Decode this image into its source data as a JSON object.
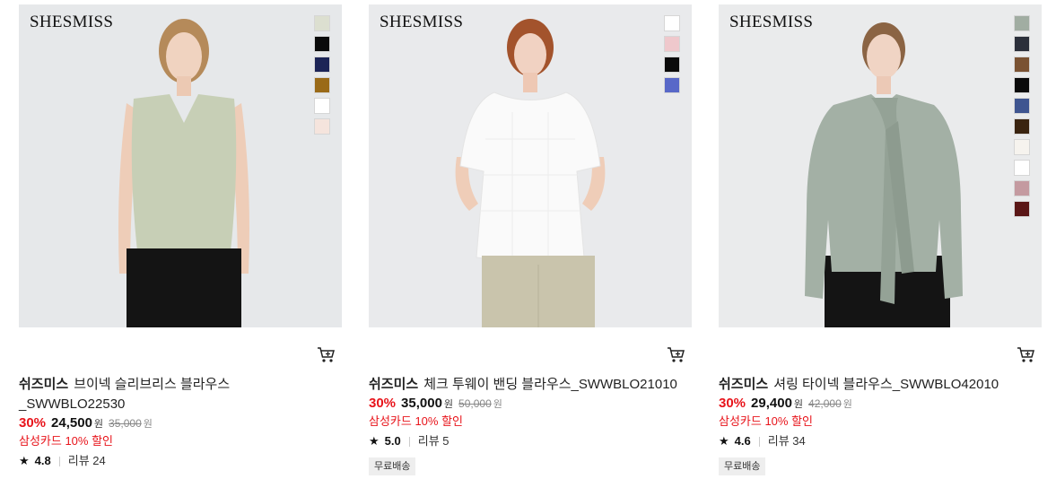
{
  "products": [
    {
      "logo": "SHESMISS",
      "brand": "쉬즈미스",
      "name": "브이넥 슬리브리스 블라우스",
      "name_cont": "_SWWBLO22530",
      "discount": "30%",
      "sale_price": "24,500",
      "currency": "원",
      "original_price": "35,000",
      "card_promo": "삼성카드 10% 할인",
      "rating": "4.8",
      "reviews": "리뷰 24",
      "free_shipping": "",
      "swatches": [
        "#dcdfd0",
        "#0a0a0a",
        "#1c2456",
        "#9a6a18",
        "#ffffff",
        "#f5e4dd"
      ]
    },
    {
      "logo": "SHESMISS",
      "brand": "쉬즈미스",
      "name": "체크 투웨이 밴딩 블라우스_SWWBLO21010",
      "name_cont": "",
      "discount": "30%",
      "sale_price": "35,000",
      "currency": "원",
      "original_price": "50,000",
      "card_promo": "삼성카드 10% 할인",
      "rating": "5.0",
      "reviews": "리뷰 5",
      "free_shipping": "무료배송",
      "swatches": [
        "#ffffff",
        "#efc8cc",
        "#0a0a0a",
        "#5868c8"
      ]
    },
    {
      "logo": "SHESMISS",
      "brand": "쉬즈미스",
      "name": "셔링 타이넥 블라우스_SWWBLO42010",
      "name_cont": "",
      "discount": "30%",
      "sale_price": "29,400",
      "currency": "원",
      "original_price": "42,000",
      "card_promo": "삼성카드 10% 할인",
      "rating": "4.6",
      "reviews": "리뷰 34",
      "free_shipping": "무료배송",
      "swatches": [
        "#a1ada2",
        "#2b2f3a",
        "#7a5232",
        "#0a0a0a",
        "#3f5590",
        "#3a2410",
        "#f6f3ee",
        "#ffffff",
        "#c49aa0",
        "#5a1616"
      ]
    }
  ]
}
